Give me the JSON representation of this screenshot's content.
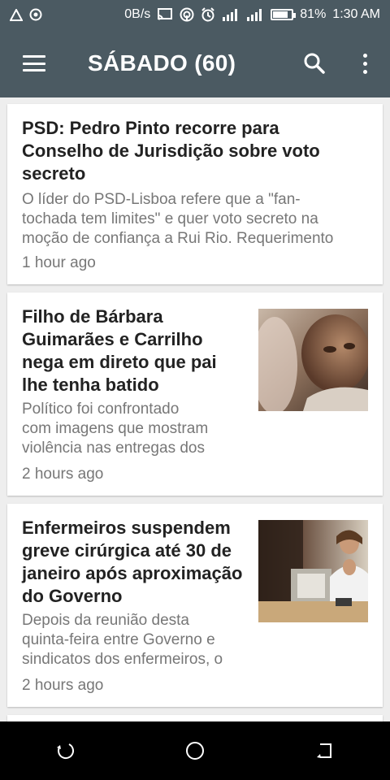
{
  "status_bar": {
    "network_speed": "0B/s",
    "battery_percent_label": "81%",
    "battery_level": 0.81,
    "time": "1:30 AM",
    "left_icons": [
      "warning-triangle-icon",
      "target-icon"
    ],
    "right_icons": [
      "cast-icon",
      "hotspot-icon",
      "alarm-icon",
      "signal-icon",
      "signal-icon-2",
      "battery-icon"
    ]
  },
  "app_bar": {
    "title": "SÁBADO (60)",
    "background": "#4b5a62",
    "icons": [
      "menu-icon",
      "search-icon",
      "more-vertical-icon"
    ]
  },
  "articles": [
    {
      "title": "PSD: Pedro Pinto recorre para Conselho de Jurisdição sobre voto secreto",
      "title_lines": [
        "PSD: Pedro Pinto recorre para",
        "Conselho de Jurisdição sobre voto",
        "secreto"
      ],
      "description": "O líder do PSD-Lisboa refere que a \"fan-tochada tem limites\" e quer voto secreto na moção de confiança a Rui Rio. Requerimento",
      "description_lines": [
        "O líder do PSD-Lisboa refere que a \"fan-",
        "tochada tem limites\" e quer voto secreto na",
        "moção de confiança a Rui Rio. Requerimento"
      ],
      "time": "1 hour ago",
      "has_image": false
    },
    {
      "title": "Filho de Bárbara Guimarães e Carrilho nega em direto que pai lhe tenha batido",
      "title_lines": [
        "Filho de Bárbara",
        "Guimarães e Carrilho",
        "nega em direto que pai",
        "lhe tenha batido"
      ],
      "description": "Político foi confrontado com imagens que mostram violência nas entregas dos",
      "description_lines": [
        "Político foi confrontado",
        "com imagens que mostram",
        "violência nas entregas dos"
      ],
      "time": "2 hours ago",
      "has_image": true,
      "image_icon": "portrait-photo-icon"
    },
    {
      "title": "Enfermeiros suspendem greve cirúrgica até 30 de janeiro após aproximação do Governo",
      "title_lines": [
        "Enfermeiros suspendem",
        "greve cirúrgica até 30 de",
        "janeiro após aproximação",
        "do Governo"
      ],
      "description": "Depois da reunião desta quinta-feira entre Governo e sindicatos dos enfermeiros, o",
      "description_lines": [
        "Depois da reunião desta",
        "quinta-feira entre Governo e",
        "sindicatos dos enfermeiros, o"
      ],
      "time": "2 hours ago",
      "has_image": true,
      "image_icon": "meeting-photo-icon"
    }
  ],
  "nav_bar": {
    "icons": [
      "back-icon",
      "home-icon",
      "recent-apps-icon"
    ]
  }
}
